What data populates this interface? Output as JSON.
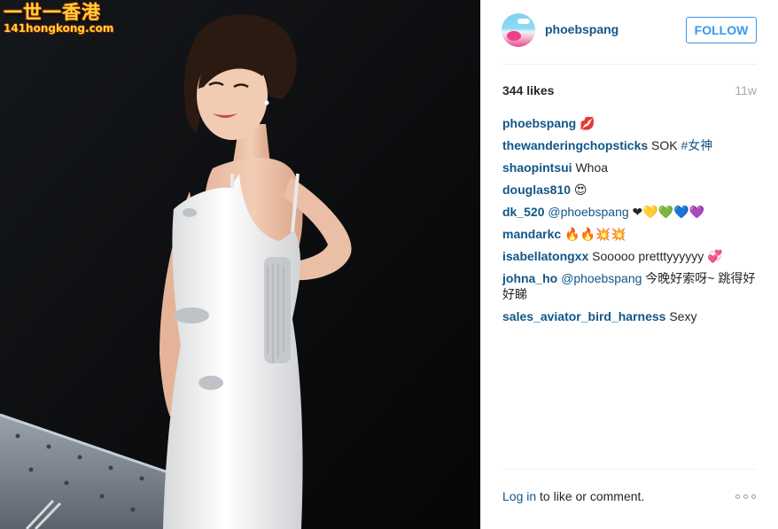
{
  "watermark": {
    "chinese": "一世一香港",
    "url": "141hongkong.com"
  },
  "post": {
    "username": "phoebspang",
    "follow_label": "FOLLOW",
    "likes": "344 likes",
    "time_ago": "11w",
    "comments": [
      {
        "user": "phoebspang",
        "text": " 💋"
      },
      {
        "user": "thewanderingchopsticks",
        "text": " SOK ",
        "tag": "#女神"
      },
      {
        "user": "shaopintsui",
        "text": " Whoa"
      },
      {
        "user": "douglas810",
        "text": " 😍"
      },
      {
        "user": "dk_520",
        "mention": " @phoebspang",
        "text": " ❤💛💚💙💜"
      },
      {
        "user": "mandarkc",
        "text": " 🔥🔥💥💥"
      },
      {
        "user": "isabellatongxx",
        "text": " Sooooo pretttyyyyyy 💞"
      },
      {
        "user": "johna_ho",
        "mention": " @phoebspang",
        "text": " 今晚好索呀~ 跳得好好睇"
      },
      {
        "user": "sales_aviator_bird_harness",
        "text": " Sexy"
      }
    ],
    "login_link": "Log in",
    "login_rest": " to like or comment.",
    "more_icon": "more-options-icon"
  },
  "colors": {
    "link": "#125688",
    "follow": "#3897f0",
    "muted": "#a5a7aa",
    "divider": "#efefef"
  }
}
